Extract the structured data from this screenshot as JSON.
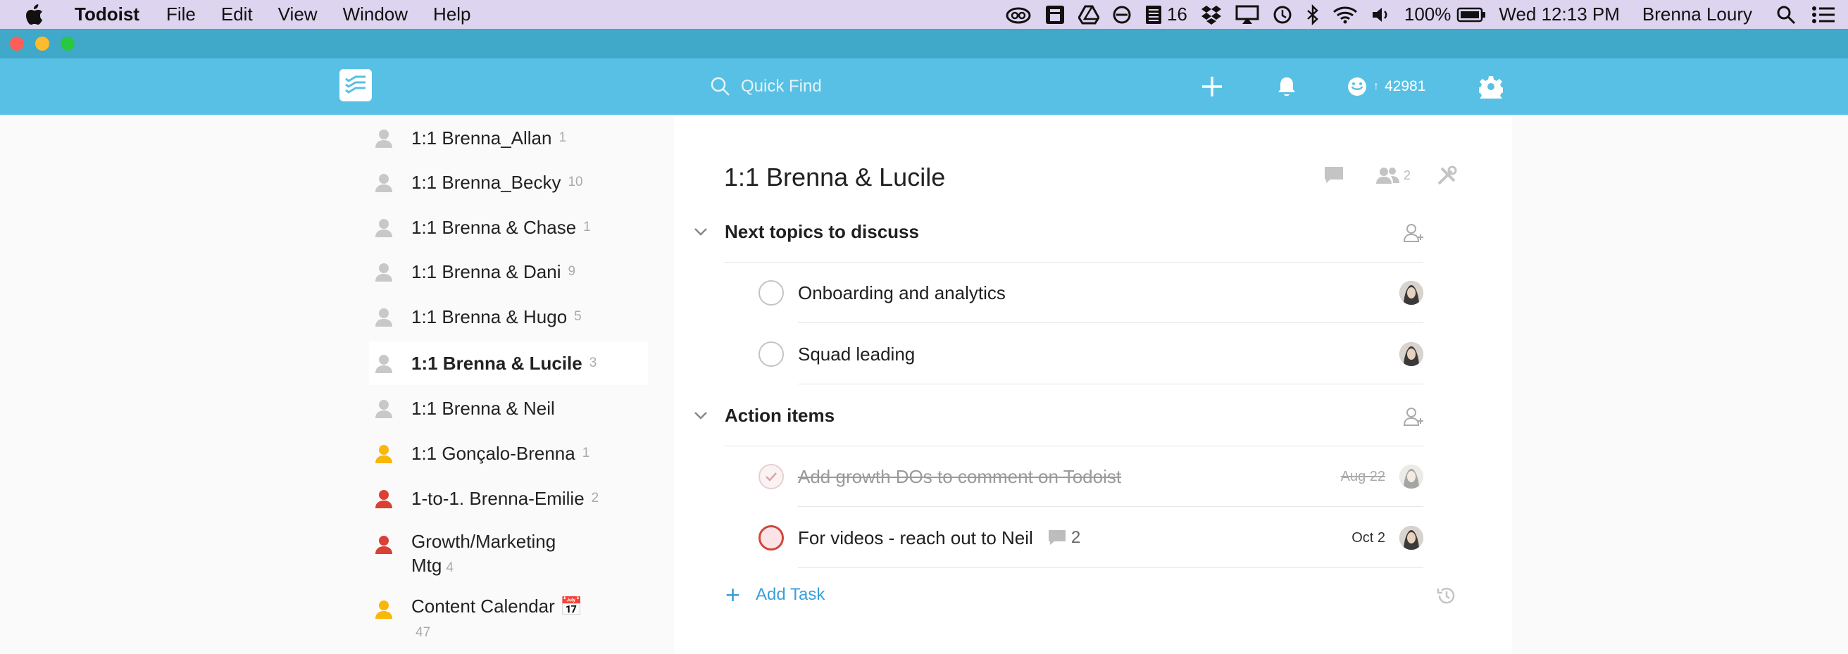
{
  "menubar": {
    "app_name": "Todoist",
    "menus": [
      "File",
      "Edit",
      "View",
      "Window",
      "Help"
    ],
    "tray_count": "16",
    "battery": "100%",
    "clock": "Wed 12:13 PM",
    "user": "Brenna Loury"
  },
  "header": {
    "search_placeholder": "Quick Find",
    "karma": "42981"
  },
  "sidebar": {
    "projects": [
      {
        "label": "1:1 Brenna_Allan",
        "count": "1",
        "color": "#c8c8c8"
      },
      {
        "label": "1:1 Brenna_Becky",
        "count": "10",
        "color": "#c8c8c8"
      },
      {
        "label": "1:1 Brenna & Chase",
        "count": "1",
        "color": "#c8c8c8"
      },
      {
        "label": "1:1 Brenna & Dani",
        "count": "9",
        "color": "#c8c8c8"
      },
      {
        "label": "1:1 Brenna & Hugo",
        "count": "5",
        "color": "#c8c8c8"
      },
      {
        "label": "1:1 Brenna & Lucile",
        "count": "3",
        "color": "#c8c8c8"
      },
      {
        "label": "1:1 Brenna & Neil",
        "count": "",
        "color": "#c8c8c8"
      },
      {
        "label": "1:1 Gonçalo-Brenna",
        "count": "1",
        "color": "#fab70a"
      },
      {
        "label": "1-to-1. Brenna-Emilie",
        "count": "2",
        "color": "#db4035"
      },
      {
        "label_line1": "Growth/Marketing",
        "label_line2": "Mtg",
        "count": "4",
        "color": "#db4035"
      },
      {
        "label": "Content Calendar",
        "emoji": "📅",
        "count": "47",
        "color": "#fab70a"
      }
    ]
  },
  "main": {
    "title": "1:1 Brenna & Lucile",
    "collaborators": "2",
    "sections": [
      {
        "name": "Next topics to discuss",
        "tasks": [
          {
            "text": "Onboarding and analytics"
          },
          {
            "text": "Squad leading"
          }
        ]
      },
      {
        "name": "Action items",
        "tasks": [
          {
            "text": "Add growth DOs to comment on Todoist",
            "date": "Aug 22"
          },
          {
            "text": "For videos - reach out to Neil",
            "comments": "2",
            "date": "Oct 2"
          }
        ]
      }
    ],
    "add_task": "Add Task"
  }
}
